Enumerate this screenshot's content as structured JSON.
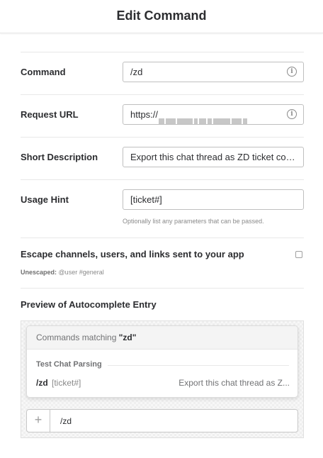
{
  "header": {
    "title": "Edit Command"
  },
  "fields": {
    "command": {
      "label": "Command",
      "value": "/zd"
    },
    "request_url": {
      "label": "Request URL",
      "value": "https://"
    },
    "short_description": {
      "label": "Short Description",
      "value": "Export this chat thread as ZD ticket com..."
    },
    "usage_hint": {
      "label": "Usage Hint",
      "value": "[ticket#]",
      "help": "Optionally list any parameters that can be passed."
    }
  },
  "escape": {
    "label": "Escape channels, users, and links sent to your app",
    "checked": false,
    "unescaped_label": "Unescaped:",
    "unescaped_example": "@user #general"
  },
  "preview": {
    "title": "Preview of Autocomplete Entry",
    "matching_prefix": "Commands matching ",
    "matching_query": "\"zd\"",
    "group_name": "Test Chat Parsing",
    "command_name": "/zd",
    "command_hint": "[ticket#]",
    "command_description": "Export this chat thread as Z...",
    "message_text": "/zd"
  },
  "icons": {
    "info": "info-icon",
    "add": "plus-icon"
  },
  "colors": {
    "text": "#2c2d30",
    "muted": "#8a8a8a",
    "border": "#bfbfbf"
  }
}
